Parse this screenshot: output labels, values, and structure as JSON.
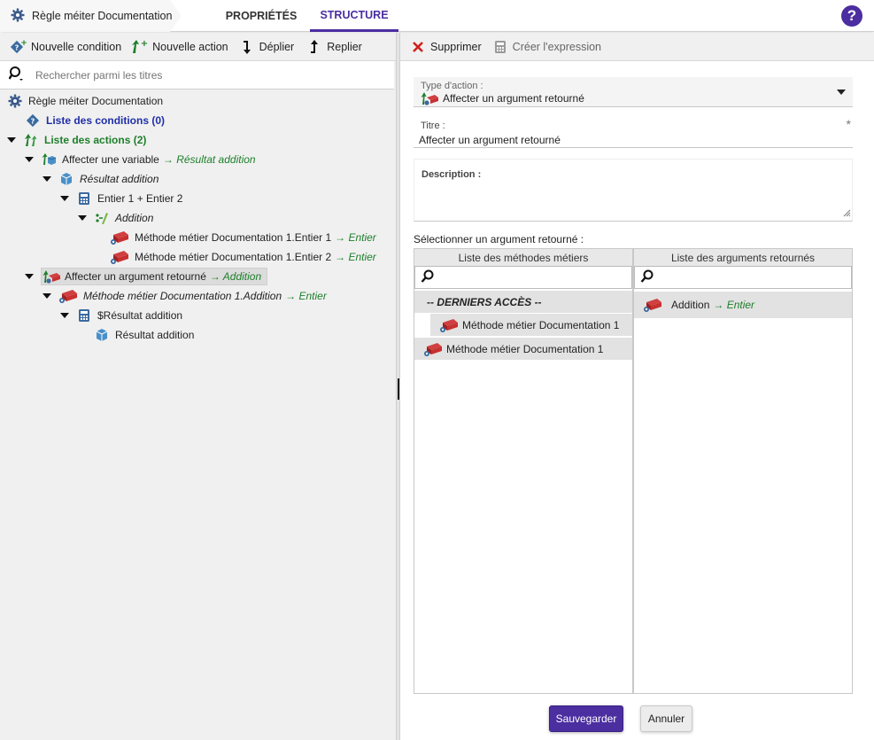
{
  "header": {
    "breadcrumb_title": "Règle méiter Documentation",
    "tabs": [
      {
        "label": "PROPRIÉTÉS",
        "active": false
      },
      {
        "label": "STRUCTURE",
        "active": true
      }
    ],
    "help_label": "?"
  },
  "left_toolbar": {
    "new_condition": "Nouvelle condition",
    "new_action": "Nouvelle action",
    "expand": "Déplier",
    "collapse": "Replier"
  },
  "left_search": {
    "placeholder": "Rechercher parmi les titres"
  },
  "tree": {
    "root": "Règle méiter Documentation",
    "conditions": "Liste des conditions (0)",
    "actions": "Liste des actions (2)",
    "a1": "Affecter une variable",
    "a1_target": "→ Résultat addition",
    "a1_var": "Résultat addition",
    "a1_expr": "Entier 1 + Entier 2",
    "a1_op": "Addition",
    "a1_arg1": "Méthode métier Documentation 1.Entier 1",
    "a1_arg2": "Méthode métier Documentation 1.Entier 2",
    "type_entier": "→ Entier",
    "a2": "Affecter un argument retourné",
    "a2_target": "→ Addition",
    "a2_method": "Méthode métier Documentation 1.Addition",
    "a2_result": "$Résultat addition",
    "a2_var": "Résultat addition"
  },
  "right_toolbar": {
    "delete": "Supprimer",
    "create_expression": "Créer l'expression"
  },
  "form": {
    "action_type_label": "Type d'action :",
    "action_type_value": "Affecter un argument retourné",
    "title_label": "Titre :",
    "title_value": "Affecter un argument retourné",
    "required_mark": "*",
    "description_label": "Description :",
    "description_value": "",
    "select_label": "Sélectionner un argument retourné :"
  },
  "methods_list": {
    "header": "Liste des méthodes métiers",
    "recent_label": "-- DERNIERS ACCÈS --",
    "recent_item": "Méthode métier Documentation 1",
    "item": "Méthode métier Documentation 1"
  },
  "returns_list": {
    "header": "Liste des arguments retournés",
    "item": "Addition",
    "item_type": "→ Entier"
  },
  "buttons": {
    "save": "Sauvegarder",
    "cancel": "Annuler"
  },
  "colors": {
    "accent": "#4b2ea0",
    "condition_blue": "#1f2ea8",
    "action_green": "#1d7f2a"
  }
}
